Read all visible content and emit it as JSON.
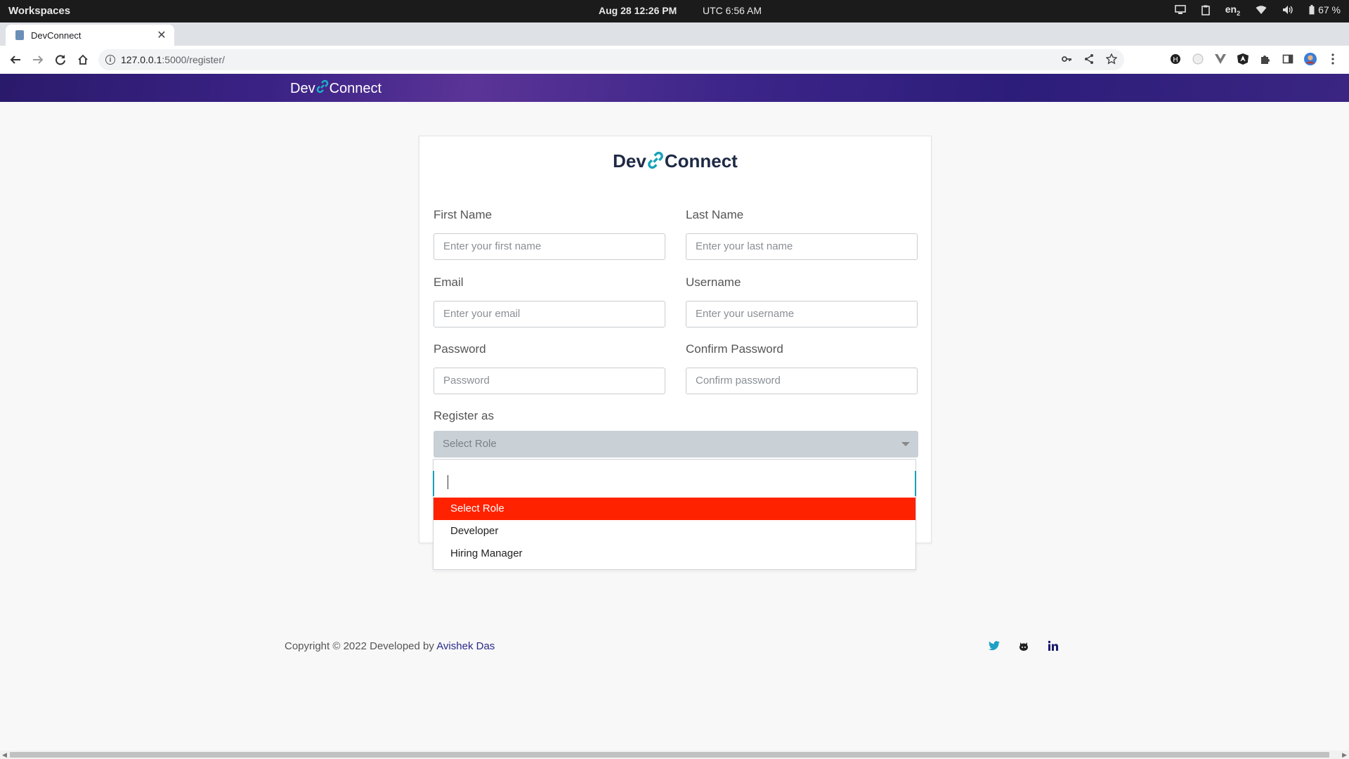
{
  "os": {
    "workspaces": "Workspaces",
    "date_time": "Aug 28  12:26 PM",
    "utc_time": "UTC 6:56 AM",
    "language": "en",
    "language_sub": "2",
    "battery": "67 %"
  },
  "browser": {
    "tab_title": "DevConnect",
    "url_host": "127.0.0.1",
    "url_rest": ":5000/register/"
  },
  "site": {
    "brand_dev": "Dev",
    "brand_connect": "Connect"
  },
  "form": {
    "first_name_label": "First Name",
    "first_name_placeholder": "Enter your first name",
    "last_name_label": "Last Name",
    "last_name_placeholder": "Enter your last name",
    "email_label": "Email",
    "email_placeholder": "Enter your email",
    "username_label": "Username",
    "username_placeholder": "Enter your username",
    "password_label": "Password",
    "password_placeholder": "Password",
    "confirm_label": "Confirm Password",
    "confirm_placeholder": "Confirm password",
    "role_label": "Register as",
    "role_selected": "Select Role",
    "role_options": [
      "Select Role",
      "Developer",
      "Hiring Manager"
    ]
  },
  "footer": {
    "copyright": "Copyright © 2022 Developed by ",
    "author": "Avishek Das"
  },
  "colors": {
    "highlight": "#ff2200",
    "accent": "#16a2b8",
    "header": "#3a2285"
  }
}
